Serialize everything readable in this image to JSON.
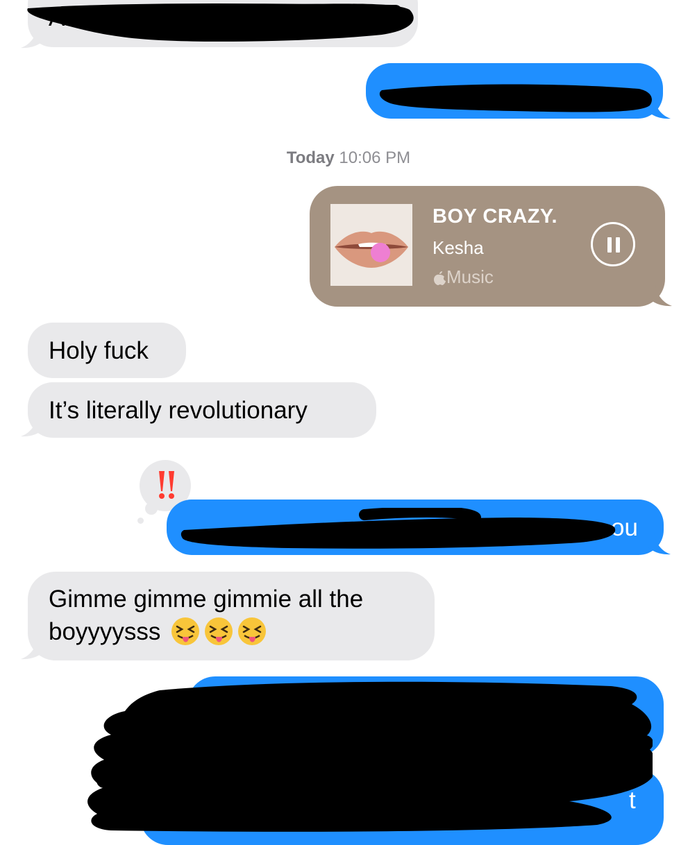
{
  "timestamp": {
    "day": "Today",
    "time": "10:06 PM"
  },
  "messages": {
    "top_received_partial": "All",
    "sent_music": {
      "title": "BOY CRAZY.",
      "artist": "Kesha",
      "source": "Music"
    },
    "received_1": "Holy fuck",
    "received_2": "It’s literally revolutionary",
    "tapback_reaction": "!!",
    "sent_2_visible_end": "ou",
    "received_3_line1": "Gimme gimme gimmie all the",
    "received_3_line2": "boyyyysss",
    "received_3_emoji": [
      "squinting-tongue-face-emoji",
      "squinting-tongue-face-emoji",
      "squinting-tongue-face-emoji"
    ],
    "sent_bottom_partial": "t"
  },
  "colors": {
    "sent": "#1f8fff",
    "received": "#e9e9eb",
    "music_card": "#a59382",
    "reaction": "#ff3b30"
  }
}
